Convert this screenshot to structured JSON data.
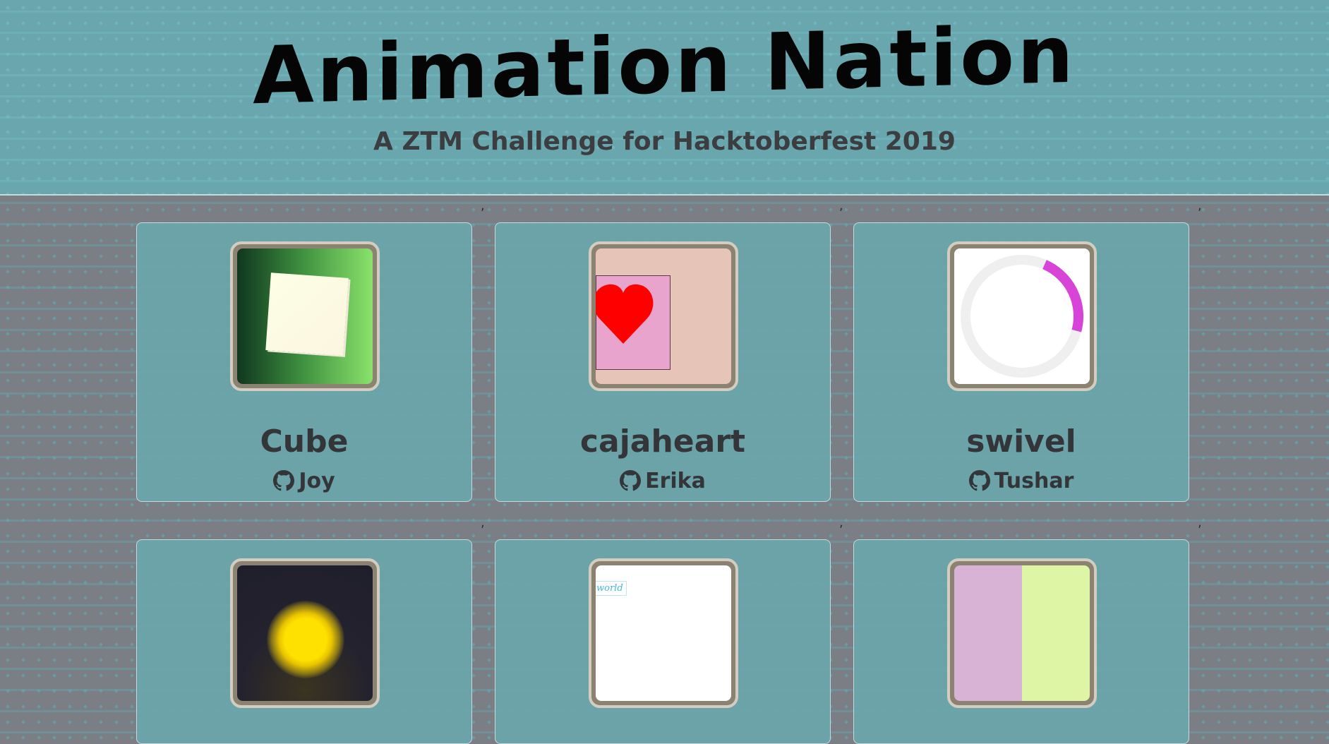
{
  "header": {
    "title": "Animation Nation",
    "subtitle": "A ZTM Challenge for Hacktoberfest 2019"
  },
  "separators": [
    ",",
    ",",
    ",",
    ",",
    ",",
    ","
  ],
  "cards": [
    {
      "title": "Cube",
      "author": "Joy",
      "icon": "github-icon"
    },
    {
      "title": "cajaheart",
      "author": "Erika",
      "icon": "github-icon"
    },
    {
      "title": "swivel",
      "author": "Tushar",
      "icon": "github-icon"
    },
    {
      "thumb": "sun-glow-animation"
    },
    {
      "thumb": "hello-world-text-animation",
      "preview_text": "world"
    },
    {
      "thumb": "split-color-animation"
    }
  ],
  "colors": {
    "header_bg": "#6aa6ad",
    "page_bg": "#7b7e84",
    "card_bg": "#6aa6ad",
    "title_text": "#050505",
    "body_text": "#333538",
    "swivel_arc": "#d843d8",
    "heart": "#ff0000"
  }
}
